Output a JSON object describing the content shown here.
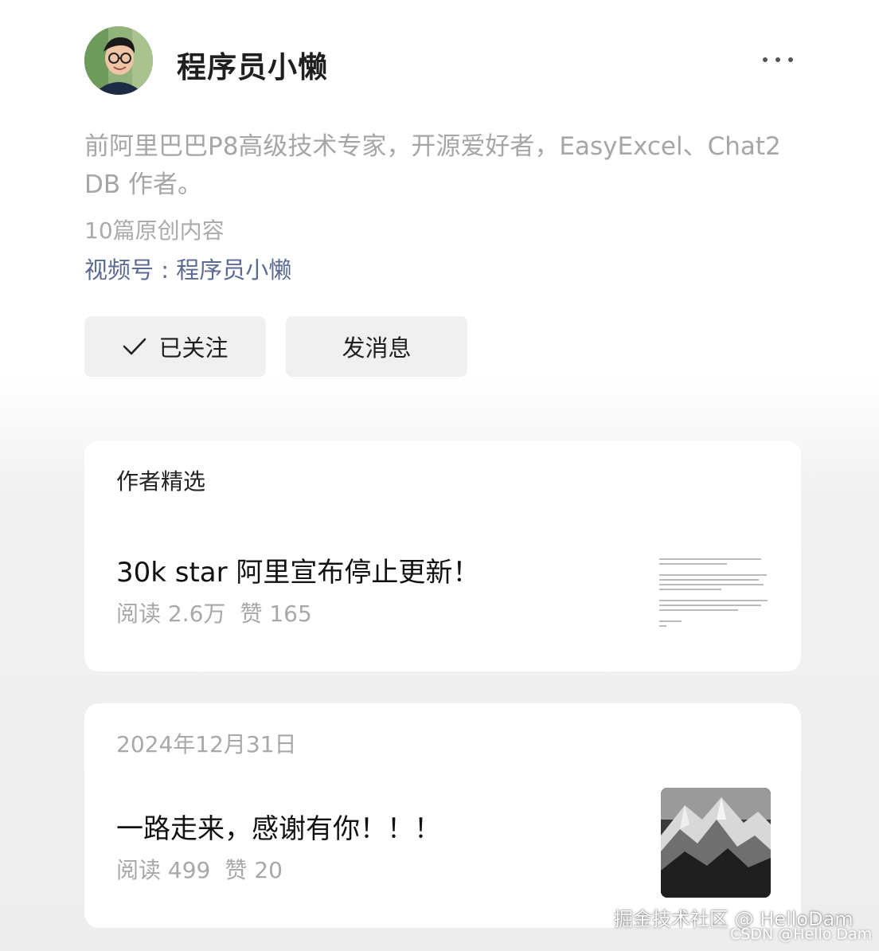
{
  "profile": {
    "name": "程序员小懒",
    "bio": "前阿里巴巴P8高级技术专家，开源爱好者，EasyExcel、Chat2DB 作者。",
    "original_count": "10篇原创内容",
    "channel_link": "视频号 : 程序员小懒"
  },
  "actions": {
    "follow_label": "已关注",
    "message_label": "发消息"
  },
  "featured": {
    "section_title": "作者精选",
    "article_title": "30k star 阿里宣布停止更新！",
    "reads": "阅读 2.6万",
    "likes": "赞 165"
  },
  "post": {
    "date": "2024年12月31日",
    "article_title": "一路走来，感谢有你！！！",
    "reads": "阅读 499",
    "likes": "赞 20"
  },
  "watermarks": {
    "juejin": "掘金技术社区 @ HelloDam",
    "csdn": "CSDN @Hello Dam"
  },
  "icons": {
    "more": "more-dots-icon",
    "check": "check-icon"
  }
}
